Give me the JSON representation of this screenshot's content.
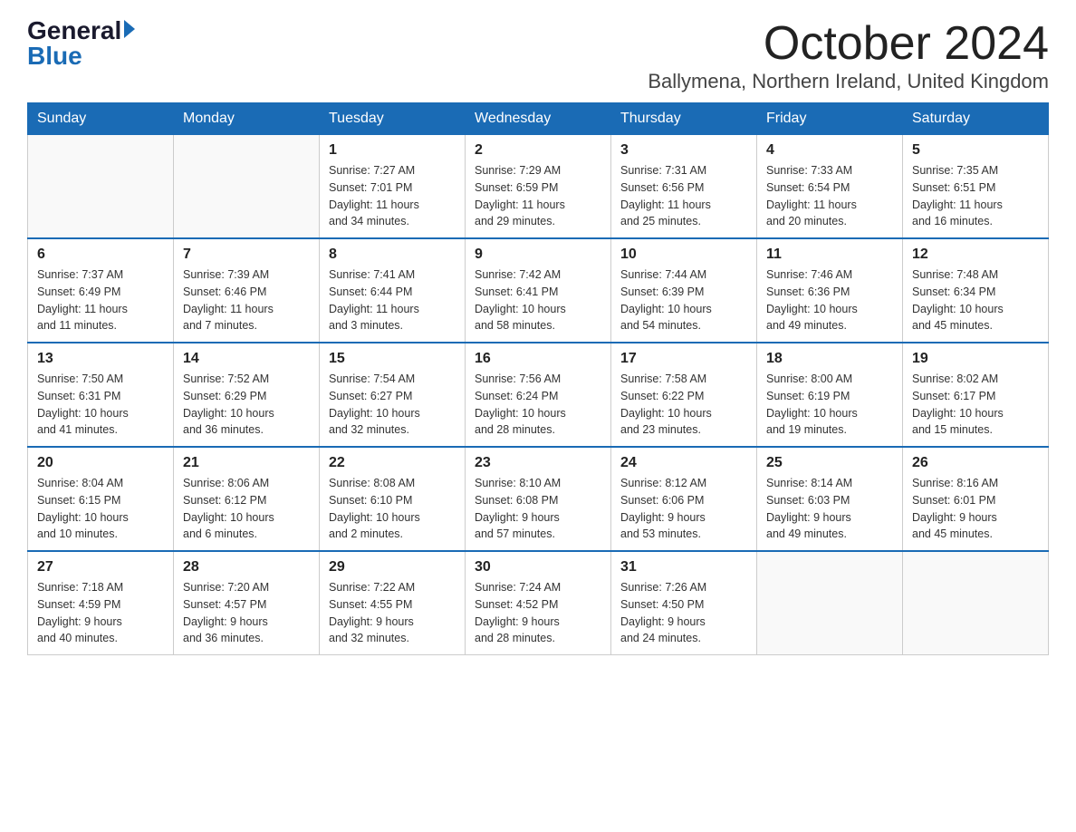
{
  "header": {
    "logo_general": "General",
    "logo_blue": "Blue",
    "month_title": "October 2024",
    "location": "Ballymena, Northern Ireland, United Kingdom"
  },
  "days_of_week": [
    "Sunday",
    "Monday",
    "Tuesday",
    "Wednesday",
    "Thursday",
    "Friday",
    "Saturday"
  ],
  "weeks": [
    [
      {
        "day": "",
        "info": ""
      },
      {
        "day": "",
        "info": ""
      },
      {
        "day": "1",
        "info": "Sunrise: 7:27 AM\nSunset: 7:01 PM\nDaylight: 11 hours\nand 34 minutes."
      },
      {
        "day": "2",
        "info": "Sunrise: 7:29 AM\nSunset: 6:59 PM\nDaylight: 11 hours\nand 29 minutes."
      },
      {
        "day": "3",
        "info": "Sunrise: 7:31 AM\nSunset: 6:56 PM\nDaylight: 11 hours\nand 25 minutes."
      },
      {
        "day": "4",
        "info": "Sunrise: 7:33 AM\nSunset: 6:54 PM\nDaylight: 11 hours\nand 20 minutes."
      },
      {
        "day": "5",
        "info": "Sunrise: 7:35 AM\nSunset: 6:51 PM\nDaylight: 11 hours\nand 16 minutes."
      }
    ],
    [
      {
        "day": "6",
        "info": "Sunrise: 7:37 AM\nSunset: 6:49 PM\nDaylight: 11 hours\nand 11 minutes."
      },
      {
        "day": "7",
        "info": "Sunrise: 7:39 AM\nSunset: 6:46 PM\nDaylight: 11 hours\nand 7 minutes."
      },
      {
        "day": "8",
        "info": "Sunrise: 7:41 AM\nSunset: 6:44 PM\nDaylight: 11 hours\nand 3 minutes."
      },
      {
        "day": "9",
        "info": "Sunrise: 7:42 AM\nSunset: 6:41 PM\nDaylight: 10 hours\nand 58 minutes."
      },
      {
        "day": "10",
        "info": "Sunrise: 7:44 AM\nSunset: 6:39 PM\nDaylight: 10 hours\nand 54 minutes."
      },
      {
        "day": "11",
        "info": "Sunrise: 7:46 AM\nSunset: 6:36 PM\nDaylight: 10 hours\nand 49 minutes."
      },
      {
        "day": "12",
        "info": "Sunrise: 7:48 AM\nSunset: 6:34 PM\nDaylight: 10 hours\nand 45 minutes."
      }
    ],
    [
      {
        "day": "13",
        "info": "Sunrise: 7:50 AM\nSunset: 6:31 PM\nDaylight: 10 hours\nand 41 minutes."
      },
      {
        "day": "14",
        "info": "Sunrise: 7:52 AM\nSunset: 6:29 PM\nDaylight: 10 hours\nand 36 minutes."
      },
      {
        "day": "15",
        "info": "Sunrise: 7:54 AM\nSunset: 6:27 PM\nDaylight: 10 hours\nand 32 minutes."
      },
      {
        "day": "16",
        "info": "Sunrise: 7:56 AM\nSunset: 6:24 PM\nDaylight: 10 hours\nand 28 minutes."
      },
      {
        "day": "17",
        "info": "Sunrise: 7:58 AM\nSunset: 6:22 PM\nDaylight: 10 hours\nand 23 minutes."
      },
      {
        "day": "18",
        "info": "Sunrise: 8:00 AM\nSunset: 6:19 PM\nDaylight: 10 hours\nand 19 minutes."
      },
      {
        "day": "19",
        "info": "Sunrise: 8:02 AM\nSunset: 6:17 PM\nDaylight: 10 hours\nand 15 minutes."
      }
    ],
    [
      {
        "day": "20",
        "info": "Sunrise: 8:04 AM\nSunset: 6:15 PM\nDaylight: 10 hours\nand 10 minutes."
      },
      {
        "day": "21",
        "info": "Sunrise: 8:06 AM\nSunset: 6:12 PM\nDaylight: 10 hours\nand 6 minutes."
      },
      {
        "day": "22",
        "info": "Sunrise: 8:08 AM\nSunset: 6:10 PM\nDaylight: 10 hours\nand 2 minutes."
      },
      {
        "day": "23",
        "info": "Sunrise: 8:10 AM\nSunset: 6:08 PM\nDaylight: 9 hours\nand 57 minutes."
      },
      {
        "day": "24",
        "info": "Sunrise: 8:12 AM\nSunset: 6:06 PM\nDaylight: 9 hours\nand 53 minutes."
      },
      {
        "day": "25",
        "info": "Sunrise: 8:14 AM\nSunset: 6:03 PM\nDaylight: 9 hours\nand 49 minutes."
      },
      {
        "day": "26",
        "info": "Sunrise: 8:16 AM\nSunset: 6:01 PM\nDaylight: 9 hours\nand 45 minutes."
      }
    ],
    [
      {
        "day": "27",
        "info": "Sunrise: 7:18 AM\nSunset: 4:59 PM\nDaylight: 9 hours\nand 40 minutes."
      },
      {
        "day": "28",
        "info": "Sunrise: 7:20 AM\nSunset: 4:57 PM\nDaylight: 9 hours\nand 36 minutes."
      },
      {
        "day": "29",
        "info": "Sunrise: 7:22 AM\nSunset: 4:55 PM\nDaylight: 9 hours\nand 32 minutes."
      },
      {
        "day": "30",
        "info": "Sunrise: 7:24 AM\nSunset: 4:52 PM\nDaylight: 9 hours\nand 28 minutes."
      },
      {
        "day": "31",
        "info": "Sunrise: 7:26 AM\nSunset: 4:50 PM\nDaylight: 9 hours\nand 24 minutes."
      },
      {
        "day": "",
        "info": ""
      },
      {
        "day": "",
        "info": ""
      }
    ]
  ]
}
